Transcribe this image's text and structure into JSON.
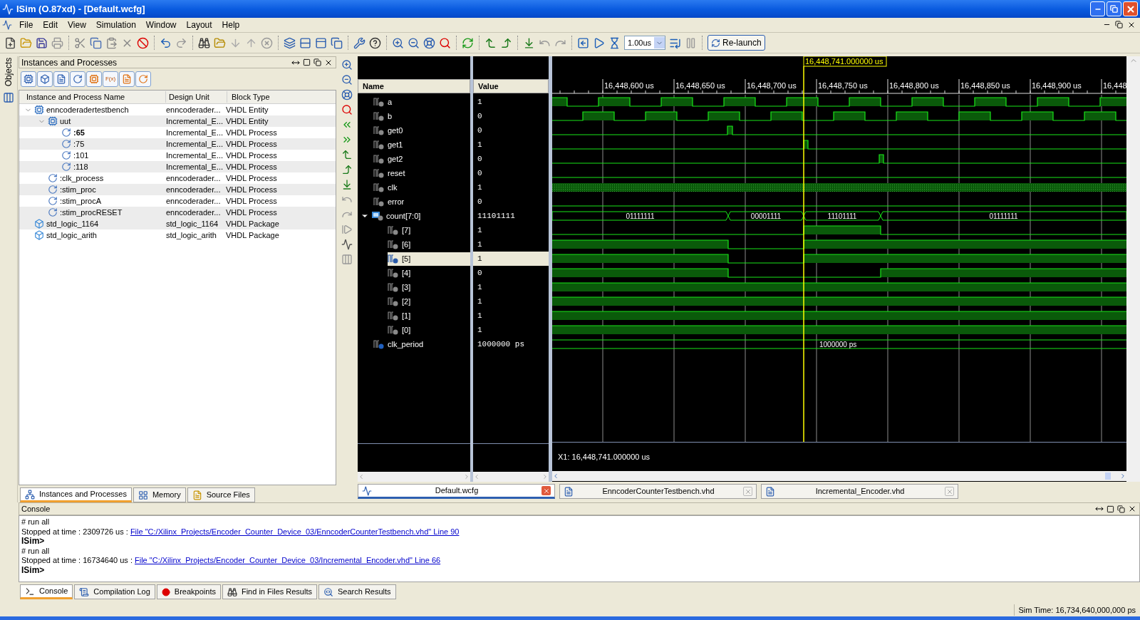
{
  "window": {
    "title": "ISim (O.87xd) - [Default.wcfg]"
  },
  "menu": [
    "File",
    "Edit",
    "View",
    "Simulation",
    "Window",
    "Layout",
    "Help"
  ],
  "toolbar": {
    "run_time": "1.00us",
    "relaunch": "Re-launch"
  },
  "side_strip": {
    "label": "Objects"
  },
  "instances_panel": {
    "title": "Instances and Processes",
    "function_filter": "F(x)",
    "columns": [
      "Instance and Process Name",
      "Design Unit",
      "Block Type"
    ],
    "tree": [
      {
        "name": "enncoderadertestbench",
        "unit": "enncoderader...",
        "type": "VHDL Entity",
        "kind": "entity",
        "current": false,
        "expanded": true,
        "children": [
          {
            "name": "uut",
            "unit": "Incremental_E...",
            "type": "VHDL Entity",
            "kind": "entity",
            "current": false,
            "expanded": true,
            "children": [
              {
                "name": ":65",
                "unit": "Incremental_E...",
                "type": "VHDL Process",
                "kind": "process",
                "current": true
              },
              {
                "name": ":75",
                "unit": "Incremental_E...",
                "type": "VHDL Process",
                "kind": "process",
                "current": false
              },
              {
                "name": ":101",
                "unit": "Incremental_E...",
                "type": "VHDL Process",
                "kind": "process",
                "current": false
              },
              {
                "name": ":118",
                "unit": "Incremental_E...",
                "type": "VHDL Process",
                "kind": "process",
                "current": false
              }
            ]
          },
          {
            "name": ":clk_process",
            "unit": "enncoderader...",
            "type": "VHDL Process",
            "kind": "process",
            "current": false
          },
          {
            "name": ":stim_proc",
            "unit": "enncoderader...",
            "type": "VHDL Process",
            "kind": "process",
            "current": false
          },
          {
            "name": ":stim_procA",
            "unit": "enncoderader...",
            "type": "VHDL Process",
            "kind": "process",
            "current": false
          },
          {
            "name": ":stim_procRESET",
            "unit": "enncoderader...",
            "type": "VHDL Process",
            "kind": "process",
            "current": false
          }
        ]
      },
      {
        "name": "std_logic_1164",
        "unit": "std_logic_1164",
        "type": "VHDL Package",
        "kind": "package",
        "current": false
      },
      {
        "name": "std_logic_arith",
        "unit": "std_logic_arith",
        "type": "VHDL Package",
        "kind": "package",
        "current": false
      }
    ],
    "tabs": [
      {
        "label": "Instances and Processes",
        "selected": true
      },
      {
        "label": "Memory",
        "selected": false
      },
      {
        "label": "Source Files",
        "selected": false
      }
    ]
  },
  "wave": {
    "columns": [
      "Name",
      "Value"
    ],
    "cursor_label": "16,448,741.000000 us",
    "ticks": [
      "16,448,600 us",
      "16,448,650 us",
      "16,448,700 us",
      "16,448,750 us",
      "16,448,800 us",
      "16,448,850 us",
      "16,448,900 us",
      "16,448"
    ],
    "signals": [
      {
        "name": "a",
        "value": "1",
        "kind": "bit",
        "selected": false
      },
      {
        "name": "b",
        "value": "0",
        "kind": "bit",
        "selected": false
      },
      {
        "name": "get0",
        "value": "0",
        "kind": "bit",
        "selected": false
      },
      {
        "name": "get1",
        "value": "1",
        "kind": "bit",
        "selected": false
      },
      {
        "name": "get2",
        "value": "0",
        "kind": "bit",
        "selected": false
      },
      {
        "name": "reset",
        "value": "0",
        "kind": "bit",
        "selected": false
      },
      {
        "name": "clk",
        "value": "1",
        "kind": "bit",
        "selected": false
      },
      {
        "name": "error",
        "value": "0",
        "kind": "bit",
        "selected": false
      },
      {
        "name": "count[7:0]",
        "value": "11101111",
        "kind": "bus",
        "selected": false,
        "expanded": true,
        "segments": [
          "01111111",
          "00001111",
          "11101111",
          "01111111"
        ],
        "children": [
          {
            "name": "[7]",
            "value": "1",
            "kind": "bit",
            "selected": false
          },
          {
            "name": "[6]",
            "value": "1",
            "kind": "bit",
            "selected": false
          },
          {
            "name": "[5]",
            "value": "1",
            "kind": "bit",
            "selected": true
          },
          {
            "name": "[4]",
            "value": "0",
            "kind": "bit",
            "selected": false
          },
          {
            "name": "[3]",
            "value": "1",
            "kind": "bit",
            "selected": false
          },
          {
            "name": "[2]",
            "value": "1",
            "kind": "bit",
            "selected": false
          },
          {
            "name": "[1]",
            "value": "1",
            "kind": "bit",
            "selected": false
          },
          {
            "name": "[0]",
            "value": "1",
            "kind": "bit",
            "selected": false
          }
        ]
      },
      {
        "name": "clk_period",
        "value": "1000000 ps",
        "kind": "constant",
        "selected": false,
        "segments": [
          "1000000 ps"
        ]
      }
    ],
    "cursor_readout": "X1: 16,448,741.000000 us"
  },
  "editor_tabs": [
    {
      "label": "Default.wcfg",
      "selected": true
    },
    {
      "label": "EnncoderCounterTestbench.vhd",
      "selected": false
    },
    {
      "label": "Incremental_Encoder.vhd",
      "selected": false
    }
  ],
  "console": {
    "title": "Console",
    "lines": [
      {
        "kind": "text",
        "text": "# run all"
      },
      {
        "kind": "stop",
        "text": "Stopped at time : 2309726 us : ",
        "link": "File \"C:/Xilinx_Projects/Encoder_Counter_Device_03/EnncoderCounterTestbench.vhd\" Line 90"
      },
      {
        "kind": "prompt",
        "text": "ISim>"
      },
      {
        "kind": "text",
        "text": "# run all"
      },
      {
        "kind": "stop",
        "text": "Stopped at time : 16734640 us : ",
        "link": "File \"C:/Xilinx_Projects/Encoder_Counter_Device_03/Incremental_Encoder.vhd\" Line 66"
      },
      {
        "kind": "prompt",
        "text": "ISim>"
      }
    ],
    "tabs": [
      {
        "label": "Console",
        "selected": true
      },
      {
        "label": "Compilation Log",
        "selected": false
      },
      {
        "label": "Breakpoints",
        "selected": false
      },
      {
        "label": "Find in Files Results",
        "selected": false
      },
      {
        "label": "Search Results",
        "selected": false
      }
    ]
  },
  "status_bar": {
    "sim_time": "Sim Time: 16,734,640,000,000 ps"
  }
}
